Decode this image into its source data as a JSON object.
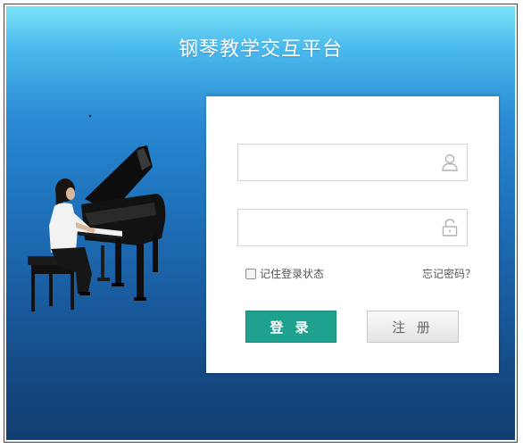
{
  "app": {
    "title": "钢琴教学交互平台"
  },
  "login": {
    "username_placeholder": "",
    "password_placeholder": "",
    "remember_label": "记住登录状态",
    "remember_checked": false,
    "forgot_label": "忘记密码？",
    "login_button": "登 录",
    "register_button": "注 册"
  },
  "icons": {
    "username": "user-icon",
    "password": "lock-icon",
    "illustration": "piano-player-illustration"
  },
  "colors": {
    "background_top": "#7be3f8",
    "background_bottom": "#113e70",
    "login_button": "#1fa190",
    "panel_accent": "#2a8fcf"
  }
}
